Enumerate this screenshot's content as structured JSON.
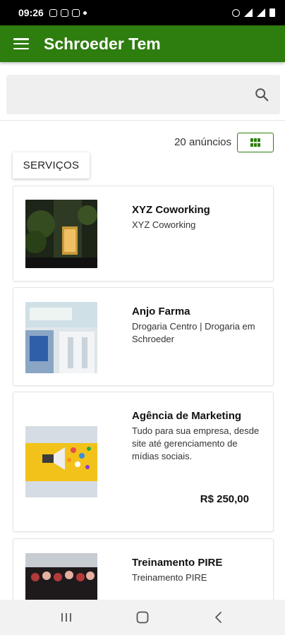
{
  "status_bar": {
    "time": "09:26"
  },
  "app_bar": {
    "title": "Schroeder Tem"
  },
  "search": {
    "placeholder": ""
  },
  "results": {
    "count_label": "20 anúncios"
  },
  "category_chip": {
    "label": "SERVIÇOS"
  },
  "listings": [
    {
      "title": "XYZ Coworking",
      "subtitle": "XYZ Coworking",
      "price": ""
    },
    {
      "title": "Anjo Farma",
      "subtitle": "Drogaria Centro | Drogaria em Schroeder",
      "price": ""
    },
    {
      "title": "Agência de Marketing",
      "subtitle": "Tudo para sua empresa, desde site até gerenciamento de mídias sociais.",
      "price": "R$ 250,00"
    },
    {
      "title": "Treinamento PIRE",
      "subtitle": "Treinamento PIRE",
      "price": ""
    }
  ],
  "colors": {
    "primary": "#2e7d0f",
    "background": "#ffffff",
    "search_bg": "#efefef"
  },
  "icons": [
    "menu-icon",
    "search-icon",
    "grid-view-icon",
    "recent-apps-icon",
    "home-icon",
    "back-icon"
  ]
}
